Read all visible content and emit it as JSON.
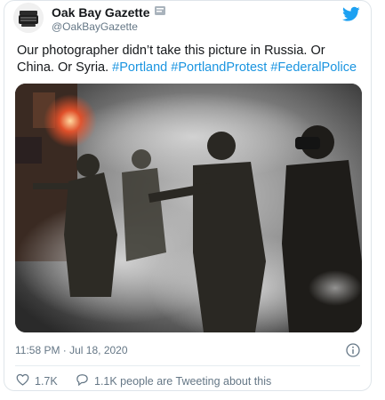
{
  "account": {
    "name": "Oak Bay Gazette",
    "handle": "@OakBayGazette"
  },
  "tweet": {
    "text_plain": "Our photographer didn’t take this picture in Russia. Or China. Or Syria. ",
    "hashtags": [
      "#Portland",
      "#PortlandProtest",
      "#FederalPolice"
    ],
    "timestamp": "11:58 PM · Jul 18, 2020"
  },
  "actions": {
    "likes": "1.7K",
    "tweeting_about": "1.1K people are Tweeting about this"
  },
  "colors": {
    "accent": "#1DA1F2",
    "link": "#1B95E0",
    "text": "#14171A",
    "muted": "#657786"
  },
  "icons": {
    "brand": "twitter-bird-icon",
    "verified": "verified-badge-icon",
    "info": "info-icon",
    "like": "heart-icon",
    "reply": "speech-bubble-icon"
  }
}
